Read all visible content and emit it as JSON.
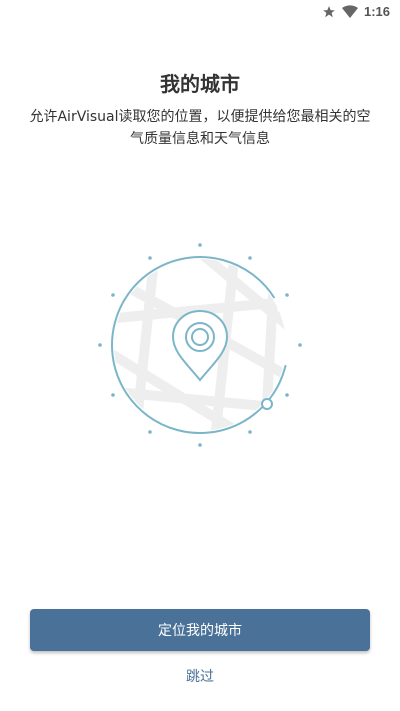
{
  "status_bar": {
    "time": "1:16",
    "icons": [
      "star-icon",
      "wifi-icon"
    ]
  },
  "header": {
    "title": "我的城市",
    "description": "允许AirVisual读取您的位置，以便提供给您最相关的空气质量信息和天气信息"
  },
  "illustration": {
    "icon": "location-map-illustration",
    "accent_color": "#7ab6c8",
    "map_color": "#efefef"
  },
  "actions": {
    "locate_label": "定位我的城市",
    "skip_label": "跳过",
    "primary_color": "#4a7198"
  }
}
